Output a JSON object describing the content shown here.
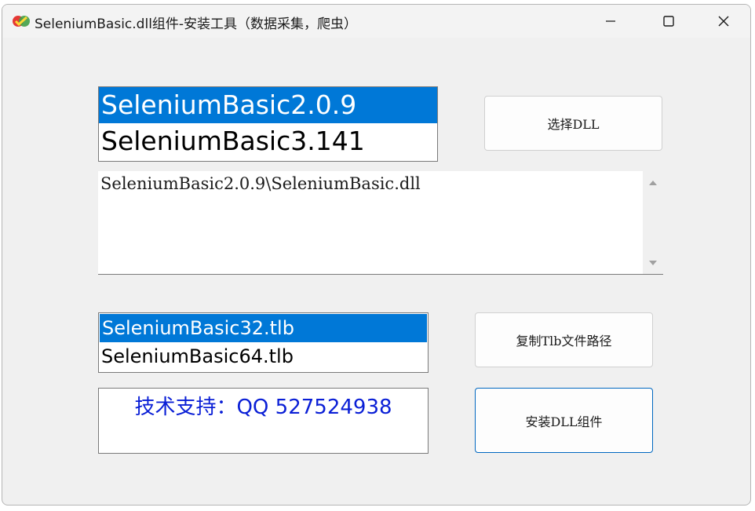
{
  "window": {
    "title": "SeleniumBasic.dll组件-安装工具（数据采集，爬虫）",
    "icon": "selenium-logo-icon"
  },
  "controls": {
    "minimize_icon": "minimize-icon",
    "maximize_icon": "maximize-icon",
    "close_icon": "close-icon"
  },
  "version_list": {
    "items": [
      {
        "label": "SeleniumBasic2.0.9",
        "selected": true
      },
      {
        "label": "SeleniumBasic3.141",
        "selected": false
      }
    ]
  },
  "buttons": {
    "select_dll": "选择DLL",
    "copy_tlb": "复制Tlb文件路径",
    "install_dll": "安装DLL组件"
  },
  "path_box": {
    "value": "SeleniumBasic2.0.9\\SeleniumBasic.dll"
  },
  "tlb_list": {
    "items": [
      {
        "label": "SeleniumBasic32.tlb",
        "selected": true
      },
      {
        "label": "SeleniumBasic64.tlb",
        "selected": false
      }
    ]
  },
  "support": {
    "text": "技术支持：QQ 527524938"
  },
  "colors": {
    "selection": "#0078d7",
    "support_text": "#0a1fd6",
    "focus_border": "#0067c0"
  }
}
